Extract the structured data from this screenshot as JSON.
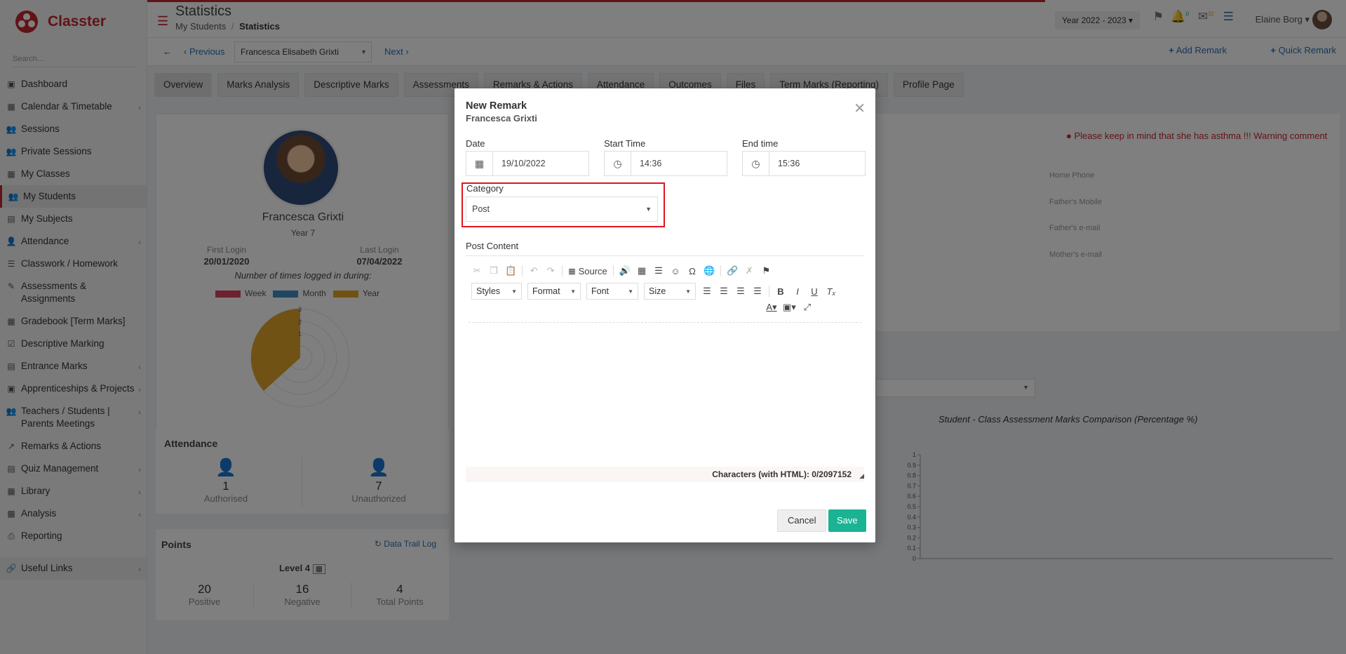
{
  "app": {
    "name": "Classter",
    "brand_color": "#c4262e",
    "accent_color": "#1ab394",
    "link_color": "#2a6fb5"
  },
  "sidebar": {
    "search_placeholder": "Search...",
    "items": [
      {
        "label": "Dashboard",
        "icon": "monitor-icon",
        "chevron": false
      },
      {
        "label": "Calendar & Timetable",
        "icon": "calendar-icon",
        "chevron": true
      },
      {
        "label": "Sessions",
        "icon": "users-icon",
        "chevron": false
      },
      {
        "label": "Private Sessions",
        "icon": "users-icon",
        "chevron": false
      },
      {
        "label": "My Classes",
        "icon": "class-icon",
        "chevron": false
      },
      {
        "label": "My Students",
        "icon": "students-icon",
        "chevron": false,
        "active": true
      },
      {
        "label": "My Subjects",
        "icon": "book-icon",
        "chevron": false
      },
      {
        "label": "Attendance",
        "icon": "attendance-icon",
        "chevron": true
      },
      {
        "label": "Classwork / Homework",
        "icon": "list-icon",
        "chevron": false
      },
      {
        "label": "Assessments & Assignments",
        "icon": "edit-icon",
        "chevron": false
      },
      {
        "label": "Gradebook [Term Marks]",
        "icon": "gradebook-icon",
        "chevron": false
      },
      {
        "label": "Descriptive Marking",
        "icon": "check-icon",
        "chevron": false
      },
      {
        "label": "Entrance Marks",
        "icon": "clipboard-icon",
        "chevron": true
      },
      {
        "label": "Apprenticeships & Projects",
        "icon": "box-icon",
        "chevron": true
      },
      {
        "label": "Teachers / Students | Parents Meetings",
        "icon": "meeting-icon",
        "chevron": true
      },
      {
        "label": "Remarks & Actions",
        "icon": "remarks-icon",
        "chevron": false
      },
      {
        "label": "Quiz Management",
        "icon": "quiz-icon",
        "chevron": true
      },
      {
        "label": "Library",
        "icon": "library-icon",
        "chevron": true
      },
      {
        "label": "Analysis",
        "icon": "analysis-icon",
        "chevron": true
      },
      {
        "label": "Reporting",
        "icon": "printer-icon",
        "chevron": false
      }
    ],
    "useful_links": "Useful Links"
  },
  "header": {
    "title": "Statistics",
    "breadcrumb_parent": "My Students",
    "breadcrumb_separator": "/",
    "breadcrumb_current": "Statistics",
    "year": "Year 2022 - 2023",
    "notification_count": "0",
    "message_count": "32",
    "user_name": "Elaine Borg"
  },
  "subbar": {
    "previous": "Previous",
    "student": "Francesca Elisabeth Grixti",
    "next": "Next",
    "add_remark": "Add Remark",
    "quick_remark": "Quick Remark"
  },
  "tabs": [
    "Overview",
    "Marks Analysis",
    "Descriptive Marks",
    "Assessments",
    "Remarks & Actions",
    "Attendance",
    "Outcomes",
    "Files",
    "Term Marks (Reporting)",
    "Profile Page"
  ],
  "profile": {
    "name": "Francesca Grixti",
    "year": "Year 7",
    "first_login_label": "First Login",
    "first_login": "20/01/2020",
    "last_login_label": "Last Login",
    "last_login": "07/04/2022",
    "logged_note": "Number of times logged in during:",
    "legend": [
      {
        "name": "Week",
        "color": "#d9455f"
      },
      {
        "name": "Month",
        "color": "#3f8fc2"
      },
      {
        "name": "Year",
        "color": "#e0a52a"
      }
    ],
    "polar_ticks": [
      "3",
      "2",
      "1"
    ]
  },
  "attendance": {
    "title": "Attendance",
    "authorised_count": "1",
    "authorised_label": "Authorised",
    "unauthorized_count": "7",
    "unauthorized_label": "Unauthorized"
  },
  "points": {
    "title": "Points",
    "data_trail": "Data Trail Log",
    "level": "Level 4",
    "positive": "20",
    "positive_label": "Positive",
    "negative": "16",
    "negative_label": "Negative",
    "total": "4",
    "total_label": "Total Points"
  },
  "right_panel": {
    "warning": "Please keep in mind that she has asthma !!! Warning comment",
    "labels": [
      "Home Phone",
      "Father's Mobile",
      "Father's e-mail",
      "Mother's e-mail"
    ],
    "chart_title": "Student - Class Assessment Marks Comparison (Percentage %)"
  },
  "chart_data": {
    "type": "bar",
    "title": "Student - Class Assessment Marks Comparison (Percentage %)",
    "ylim": [
      0,
      1
    ],
    "y_ticks": [
      "1",
      "0.9",
      "0.8",
      "0.7",
      "0.6",
      "0.5",
      "0.4",
      "0.3",
      "0.2",
      "0.1",
      "0"
    ],
    "categories": [],
    "series": []
  },
  "modal": {
    "title": "New Remark",
    "subtitle": "Francesca Grixti",
    "date_label": "Date",
    "date": "19/10/2022",
    "start_label": "Start Time",
    "start": "14:36",
    "end_label": "End time",
    "end": "15:36",
    "category_label": "Category",
    "category": "Post",
    "content_label": "Post Content",
    "editor": {
      "source": "Source",
      "styles": "Styles",
      "format": "Format",
      "font": "Font",
      "size": "Size",
      "char_count": "Characters (with HTML): 0/2097152"
    },
    "cancel": "Cancel",
    "save": "Save",
    "highlight_color": "#e0161e"
  }
}
